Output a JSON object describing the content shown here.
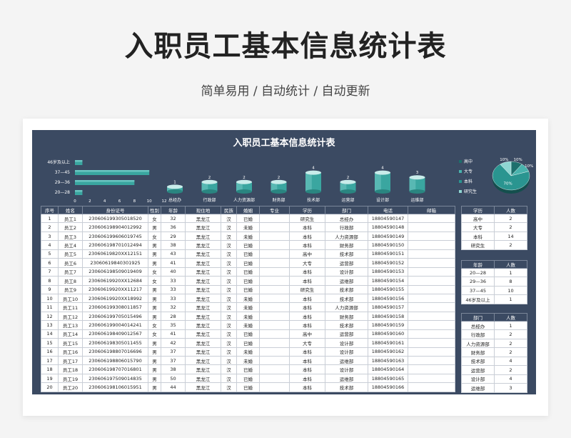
{
  "hero": {
    "title": "入职员工基本信息统计表",
    "subtitle": "简单易用 / 自动统计 / 自动更新"
  },
  "sheet": {
    "title": "入职员工基本信息统计表"
  },
  "colors": {
    "header": "#3b4a62",
    "teal": "#3aa6a0",
    "dark_teal": "#1d6f6c"
  },
  "chart_data": [
    {
      "type": "bar",
      "orientation": "horizontal",
      "categories": [
        "46岁及以上",
        "37—45",
        "29—36",
        "20—28"
      ],
      "values": [
        1,
        10,
        8,
        1
      ],
      "xticks": [
        "0",
        "2",
        "4",
        "6",
        "8",
        "10",
        "12"
      ],
      "xlim": [
        0,
        12
      ]
    },
    {
      "type": "bar",
      "style": "cylinder",
      "categories": [
        "总经办",
        "行政部",
        "人力资源部",
        "财务部",
        "技术部",
        "运营部",
        "设计部",
        "运维部"
      ],
      "values": [
        1,
        2,
        2,
        2,
        4,
        2,
        4,
        3
      ]
    },
    {
      "type": "pie",
      "categories": [
        "高中",
        "大专",
        "本科",
        "研究生"
      ],
      "values": [
        2,
        2,
        14,
        2
      ],
      "labels": [
        "10%",
        "10%",
        "70%",
        "10%"
      ],
      "legend": "left"
    }
  ],
  "main_table": {
    "headers": [
      "序号",
      "姓名",
      "身份证号",
      "性别",
      "年龄",
      "现住地",
      "民族",
      "婚姻",
      "专业",
      "学历",
      "部门",
      "电话",
      "邮箱"
    ],
    "rows": [
      [
        "1",
        "员工1",
        "230606199305018520",
        "女",
        "32",
        "黑龙江",
        "汉",
        "已婚",
        "",
        "研究生",
        "总经办",
        "18804590147",
        ""
      ],
      [
        "2",
        "员工2",
        "230606198904012992",
        "男",
        "36",
        "黑龙江",
        "汉",
        "未婚",
        "",
        "本科",
        "行政部",
        "18804590148",
        ""
      ],
      [
        "3",
        "员工3",
        "230606199606019745",
        "女",
        "29",
        "黑龙江",
        "汉",
        "未婚",
        "",
        "本科",
        "人力资源部",
        "18804590149",
        ""
      ],
      [
        "4",
        "员工4",
        "230606198701012494",
        "男",
        "38",
        "黑龙江",
        "汉",
        "已婚",
        "",
        "本科",
        "财务部",
        "18804590150",
        ""
      ],
      [
        "5",
        "员工5",
        "23060619820XX12151",
        "男",
        "43",
        "黑龙江",
        "汉",
        "已婚",
        "",
        "高中",
        "技术部",
        "18804590151",
        ""
      ],
      [
        "6",
        "员工6",
        "230606198403019​25",
        "男",
        "41",
        "黑龙江",
        "汉",
        "已婚",
        "",
        "大专",
        "运营部",
        "18804590152",
        ""
      ],
      [
        "7",
        "员工7",
        "230606198509019409",
        "女",
        "40",
        "黑龙江",
        "汉",
        "已婚",
        "",
        "本科",
        "设计部",
        "18804590153",
        ""
      ],
      [
        "8",
        "员工8",
        "23060619920XX12684",
        "女",
        "33",
        "黑龙江",
        "汉",
        "已婚",
        "",
        "本科",
        "运维部",
        "18804590154",
        ""
      ],
      [
        "9",
        "员工9",
        "23060619920XX11217",
        "男",
        "33",
        "黑龙江",
        "汉",
        "已婚",
        "",
        "研究生",
        "技术部",
        "18804590155",
        ""
      ],
      [
        "10",
        "员工10",
        "23060619920XX18992",
        "男",
        "33",
        "黑龙江",
        "汉",
        "未婚",
        "",
        "本科",
        "技术部",
        "18804590156",
        ""
      ],
      [
        "11",
        "员工11",
        "230606199308011857",
        "男",
        "32",
        "黑龙江",
        "汉",
        "未婚",
        "",
        "本科",
        "人力资源部",
        "18804590157",
        ""
      ],
      [
        "12",
        "员工12",
        "230606199705015496",
        "男",
        "28",
        "黑龙江",
        "汉",
        "未婚",
        "",
        "本科",
        "财务部",
        "18804590158",
        ""
      ],
      [
        "13",
        "员工13",
        "230606199004014241",
        "女",
        "35",
        "黑龙江",
        "汉",
        "未婚",
        "",
        "本科",
        "技术部",
        "18804590159",
        ""
      ],
      [
        "14",
        "员工14",
        "230606198409012567",
        "女",
        "41",
        "黑龙江",
        "汉",
        "已婚",
        "",
        "高中",
        "运营部",
        "18804590160",
        ""
      ],
      [
        "15",
        "员工15",
        "230606198305011455",
        "男",
        "42",
        "黑龙江",
        "汉",
        "已婚",
        "",
        "大专",
        "设计部",
        "18804590161",
        ""
      ],
      [
        "16",
        "员工16",
        "230606198807016696",
        "男",
        "37",
        "黑龙江",
        "汉",
        "未婚",
        "",
        "本科",
        "设计部",
        "18804590162",
        ""
      ],
      [
        "17",
        "员工17",
        "230606198806015790",
        "男",
        "37",
        "黑龙江",
        "汉",
        "未婚",
        "",
        "本科",
        "运维部",
        "18804590163",
        ""
      ],
      [
        "18",
        "员工18",
        "230606198707016801",
        "男",
        "38",
        "黑龙江",
        "汉",
        "已婚",
        "",
        "本科",
        "设计部",
        "18804590164",
        ""
      ],
      [
        "19",
        "员工19",
        "230606197509014835",
        "男",
        "50",
        "黑龙江",
        "汉",
        "已婚",
        "",
        "本科",
        "运维部",
        "18804590165",
        ""
      ],
      [
        "20",
        "员工20",
        "230606198106015951",
        "男",
        "44",
        "黑龙江",
        "汉",
        "已婚",
        "",
        "本科",
        "技术部",
        "18804590166",
        ""
      ]
    ]
  },
  "edu_table": {
    "headers": [
      "学历",
      "人数"
    ],
    "rows": [
      [
        "高中",
        "2"
      ],
      [
        "大专",
        "2"
      ],
      [
        "本科",
        "14"
      ],
      [
        "研究生",
        "2"
      ]
    ]
  },
  "age_table": {
    "headers": [
      "年龄",
      "人数"
    ],
    "rows": [
      [
        "20—28",
        "1"
      ],
      [
        "29—36",
        "8"
      ],
      [
        "37—45",
        "10"
      ],
      [
        "46岁及以上",
        "1"
      ]
    ]
  },
  "dept_table": {
    "headers": [
      "部门",
      "人数"
    ],
    "rows": [
      [
        "总经办",
        "1"
      ],
      [
        "行政部",
        "2"
      ],
      [
        "人力资源部",
        "2"
      ],
      [
        "财务部",
        "2"
      ],
      [
        "技术部",
        "4"
      ],
      [
        "运营部",
        "2"
      ],
      [
        "设计部",
        "4"
      ],
      [
        "运维部",
        "3"
      ]
    ]
  }
}
